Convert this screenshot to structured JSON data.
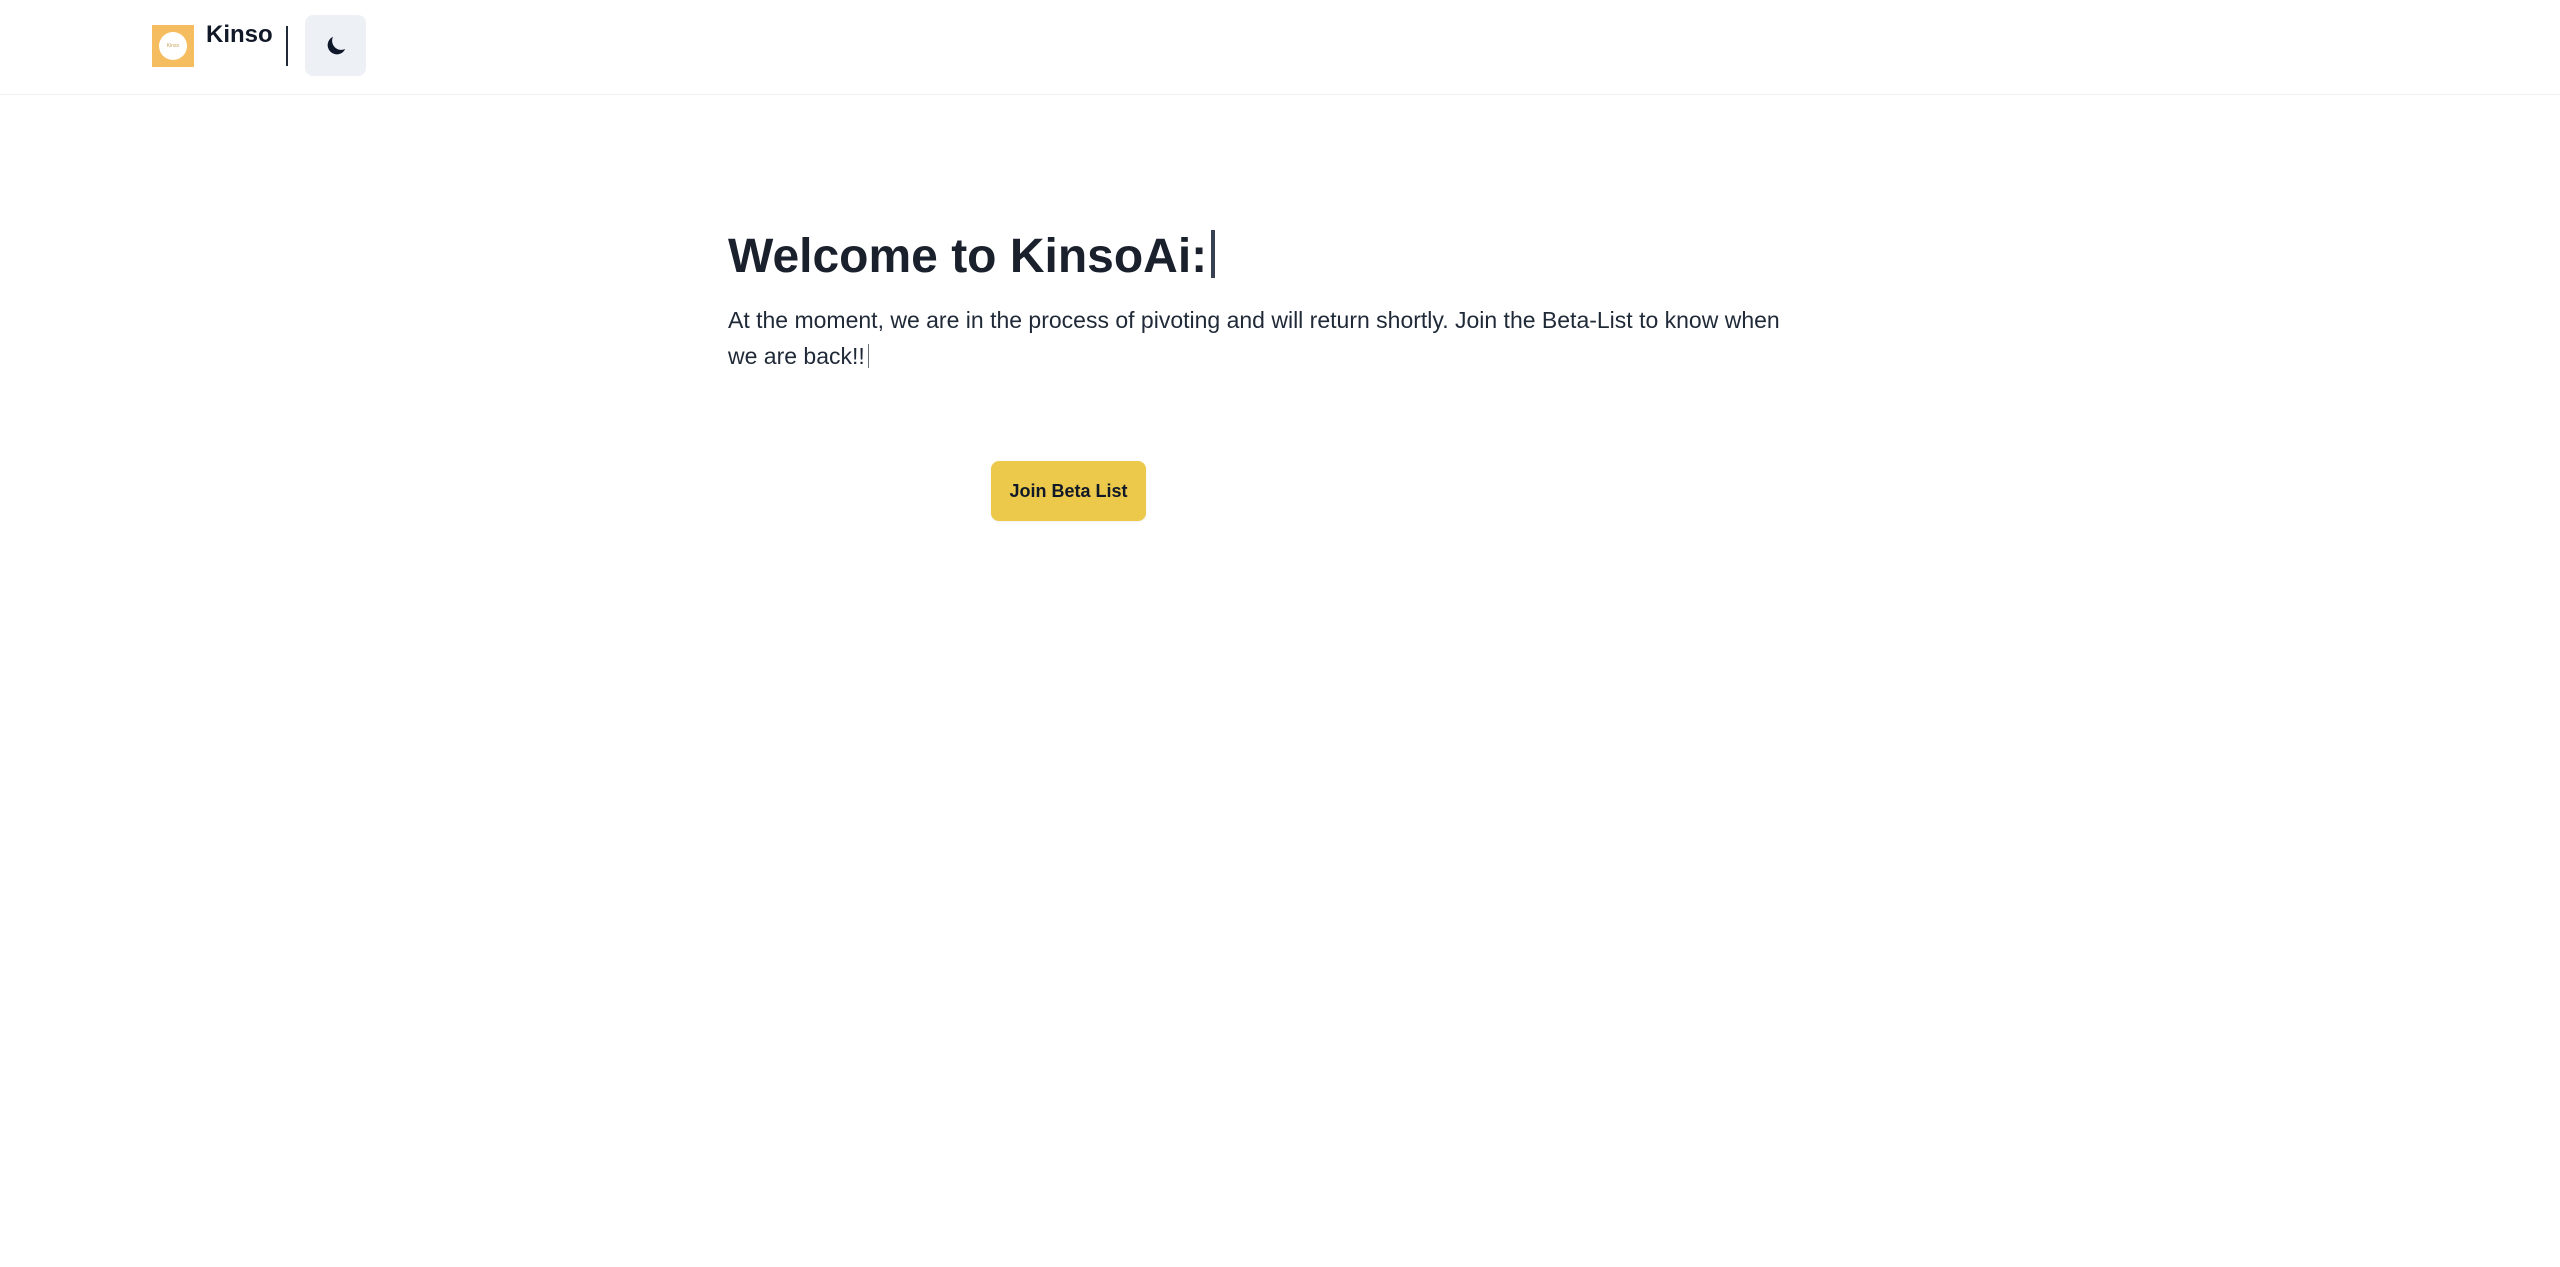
{
  "header": {
    "brand": "Kinso",
    "logo_text": "Kinso",
    "theme_toggle_icon": "moon-icon",
    "logo_color": "#f6bd60"
  },
  "hero": {
    "title": "Welcome to KinsoAi:",
    "subtitle": "At the moment, we are in the process of pivoting and will return shortly. Join the Beta-List to know when we are back!!",
    "cta_label": "Join Beta List",
    "cta_color": "#ecc94b"
  }
}
